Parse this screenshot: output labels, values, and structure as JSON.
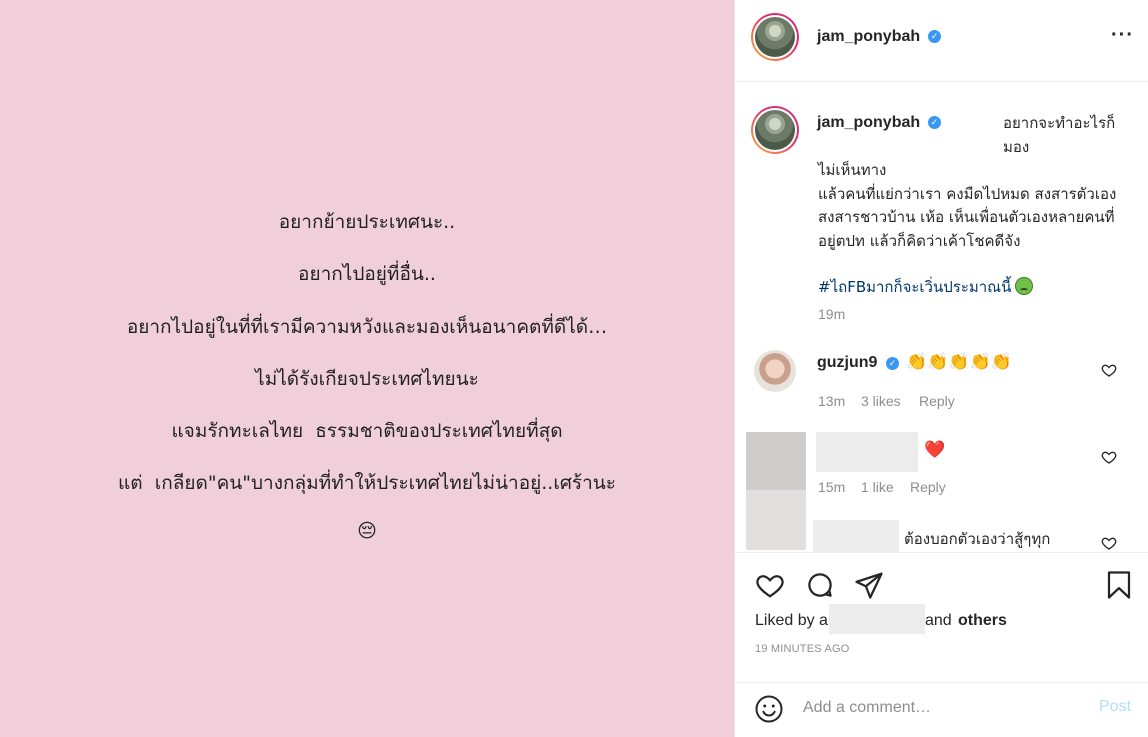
{
  "image": {
    "lines": [
      "อยากย้ายประเทศนะ..",
      "อยากไปอยู่ที่อื่น..",
      "อยากไปอยู่ในที่ที่เรามีความหวังและมองเห็นอนาคตที่ดีได้…",
      "ไม่ได้รังเกียจประเทศไทยนะ",
      "แจมรักทะเลไทย  ธรรมชาติของประเทศไทยที่สุด",
      "แต่  เกลียด\"คน\"บางกลุ่มที่ทำให้ประเทศไทยไม่น่าอยู่..เศร้านะ",
      "😔"
    ]
  },
  "header": {
    "username": "jam_ponybah",
    "more_icon": "ellipsis-icon"
  },
  "caption": {
    "username": "jam_ponybah",
    "line1": "อยากจะทำอะไรก็มอง",
    "rest": "ไม่เห็นทาง\nแล้วคนที่แย่กว่าเรา คงมืดไปหมด สงสารตัวเอง สงสารชาวบ้าน เห้อ เห็นเพื่อนตัวเองหลายคนที่อยู่ตปท แล้วก็คิดว่าเค้าโชคดีจัง",
    "hashtag": "#ไถFBมากก็จะเวิ่นประมาณนี้",
    "time": "19m"
  },
  "comments": [
    {
      "username": "guzjun9",
      "text": "👏👏👏👏👏",
      "time": "13m",
      "likes": "3 likes",
      "reply": "Reply"
    },
    {
      "text": "❤️",
      "time": "15m",
      "likes": "1 like",
      "reply": "Reply"
    },
    {
      "text": "ต้องบอกตัวเองว่าสู้ๆทุก"
    }
  ],
  "actions": {
    "liked_prefix": "Liked by a",
    "liked_suffix": "and",
    "others": "others",
    "timestamp": "19 MINUTES AGO"
  },
  "comment_box": {
    "placeholder": "Add a comment…",
    "post_label": "Post"
  },
  "colors": {
    "image_bg": "#f0cfdb",
    "link": "#00376b",
    "verified": "#3897f0",
    "post_disabled": "#b2dffc"
  }
}
